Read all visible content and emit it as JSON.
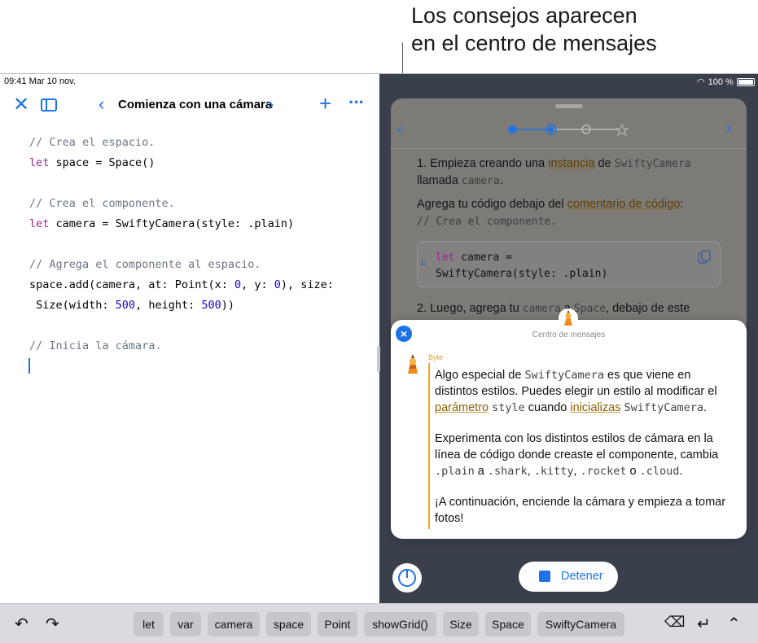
{
  "callout": {
    "line1": "Los consejos aparecen",
    "line2": "en el centro de mensajes"
  },
  "status": {
    "time": "09:41  Mar 10 nov.",
    "battery": "100 %"
  },
  "toolbar": {
    "close_icon": "close-icon",
    "sidebar_icon": "sidebar-icon",
    "prev_icon": "chevron-left-icon",
    "title": "Comienza con una cámara",
    "next_icon": "chevron-right-icon",
    "add_icon": "plus-icon",
    "more_icon": "ellipsis-icon"
  },
  "code": {
    "c1": "// Crea el espacio.",
    "l1_kw": "let",
    "l1_rest": " space = Space()",
    "c2": "// Crea el componente.",
    "l2_kw": "let",
    "l2_rest": " camera = SwiftyCamera(style: .plain)",
    "c3": "// Agrega el componente al espacio.",
    "l3a": "space.add(camera, at: Point(x: ",
    "l3_n1": "0",
    "l3b": ", y: ",
    "l3_n2": "0",
    "l3c": "), size:",
    "l4a": " Size(width: ",
    "l4_n1": "500",
    "l4b": ", height: ",
    "l4_n2": "500",
    "l4c": "))",
    "c4": "// Inicia la cámara."
  },
  "guide": {
    "p1_a": "1. Empieza creando una ",
    "p1_link": "instancia",
    "p1_b": " de ",
    "p1_code": "SwiftyCamera",
    "p1_c": "llamada ",
    "p1_code2": "camera",
    "p1_d": ".",
    "p2_a": "Agrega tu código debajo del ",
    "p2_link": "comentario de código",
    "p2_b": ":",
    "p2_code": "// Crea el componente.",
    "box_line1_kw": "let",
    "box_line1_rest": " camera =",
    "box_line2": " SwiftyCamera(style: .plain)",
    "p3_a": "2. Luego, agrega tu ",
    "p3_code": "camera",
    "p3_b": " a ",
    "p3_code2": "Space",
    "p3_c": ", debajo de este"
  },
  "message_center": {
    "title": "Centro de mensajes",
    "sender": "Byte",
    "m1_a": "Algo especial de ",
    "m1_code": "SwiftyCamera",
    "m1_b": " es que viene en distintos estilos. Puedes elegir un estilo al modificar el ",
    "m1_link1": "parámetro",
    "m1_code2": "style",
    "m1_c": " cuando ",
    "m1_link2": "inicializas",
    "m1_code3": "SwiftyCamera",
    "m1_d": ".",
    "m2_a": "Experimenta con los distintos estilos de cámara en la línea de código donde creaste el componente, cambia ",
    "m2_c1": ".plain",
    "m2_b": " a ",
    "m2_c2": ".shark",
    "m2_c": ", ",
    "m2_c3": ".kitty",
    "m2_d": ", ",
    "m2_c4": ".rocket",
    "m2_e": " o ",
    "m2_c5": ".cloud",
    "m2_f": ".",
    "m3": "¡A continuación, enciende la cámara y empieza a tomar fotos!"
  },
  "controls": {
    "stop_label": "Detener"
  },
  "shortcuts": {
    "chips": [
      "let",
      "var",
      "camera",
      "space",
      "Point",
      "showGrid()",
      "Size",
      "Space",
      "SwiftyCamera"
    ]
  },
  "colors": {
    "accent": "#1f73e8",
    "byte_orange": "#f5a623",
    "keyword": "#9b2393",
    "number": "#1c00cf"
  }
}
